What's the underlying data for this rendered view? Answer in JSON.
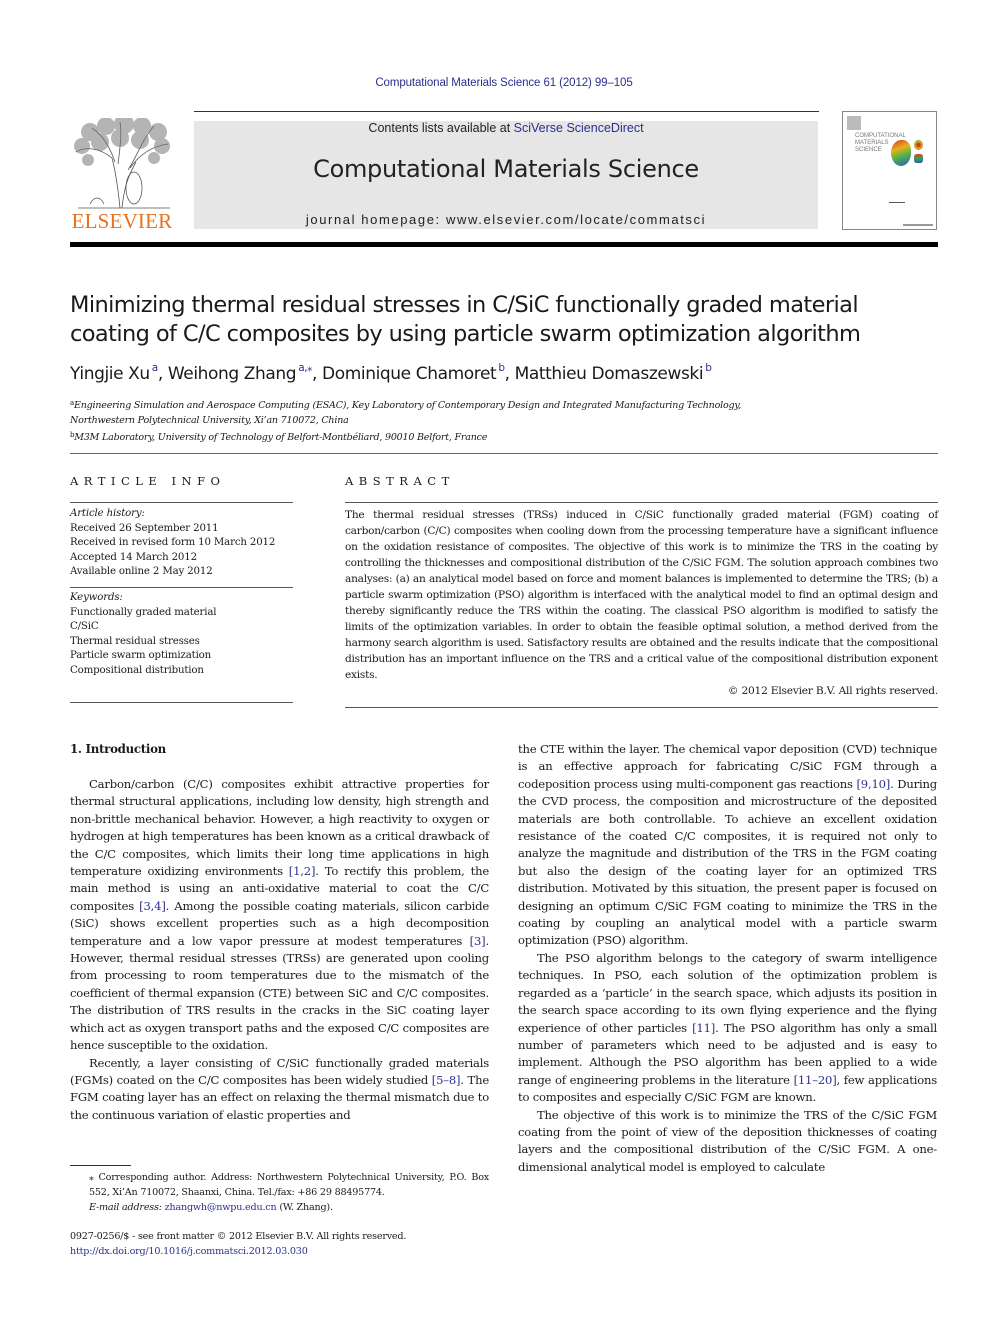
{
  "header": {
    "citation": "Computational Materials Science 61 (2012) 99–105",
    "contents_prefix": "Contents lists available at ",
    "contents_link": "SciVerse ScienceDirect",
    "journal_title": "Computational Materials Science",
    "homepage_prefix": "journal homepage: ",
    "homepage_url": "www.elsevier.com/locate/commatsci",
    "publisher_logo": "ELSEVIER",
    "cover_title_lines": [
      "COMPUTATIONAL",
      "MATERIALS",
      "SCIENCE"
    ],
    "colors": {
      "link": "#2b2f8f",
      "elsevier_orange": "#e9711c",
      "banner_bg": "#e6e6e6"
    }
  },
  "article": {
    "title_line1": "Minimizing thermal residual stresses in C/SiC functionally graded material",
    "title_line2": "coating of C/C composites by using particle swarm optimization algorithm",
    "authors": [
      {
        "name": "Yingjie Xu",
        "sup": "a"
      },
      {
        "name": "Weihong Zhang",
        "sup": "a,⁎"
      },
      {
        "name": "Dominique Chamoret",
        "sup": "b"
      },
      {
        "name": "Matthieu Domaszewski",
        "sup": "b"
      }
    ],
    "affiliations": [
      {
        "mark": "a",
        "line1": "Engineering Simulation and Aerospace Computing (ESAC), Key Laboratory of Contemporary Design and Integrated Manufacturing Technology,",
        "line2": "Northwestern Polytechnical University, Xi’an 710072, China"
      },
      {
        "mark": "b",
        "line1": "M3M Laboratory, University of Technology of Belfort-Montbéliard, 90010 Belfort, France"
      }
    ]
  },
  "article_info": {
    "heading": "ARTICLE INFO",
    "history_label": "Article history:",
    "history": [
      "Received 26 September 2011",
      "Received in revised form 10 March 2012",
      "Accepted 14 March 2012",
      "Available online 2 May 2012"
    ],
    "keywords_label": "Keywords:",
    "keywords": [
      "Functionally graded material",
      "C/SiC",
      "Thermal residual stresses",
      "Particle swarm optimization",
      "Compositional distribution"
    ]
  },
  "abstract": {
    "heading": "ABSTRACT",
    "text": "The thermal residual stresses (TRSs) induced in C/SiC functionally graded material (FGM) coating of carbon/carbon (C/C) composites when cooling down from the processing temperature have a significant influence on the oxidation resistance of composites. The objective of this work is to minimize the TRS in the coating by controlling the thicknesses and compositional distribution of the C/SiC FGM. The solution approach combines two analyses: (a) an analytical model based on force and moment balances is implemented to determine the TRS; (b) a particle swarm optimization (PSO) algorithm is interfaced with the analytical model to find an optimal design and thereby significantly reduce the TRS within the coating. The classical PSO algorithm is modified to satisfy the limits of the optimization variables. In order to obtain the feasible optimal solution, a method derived from the harmony search algorithm is used. Satisfactory results are obtained and the results indicate that the compositional distribution has an important influence on the TRS and a critical value of the compositional distribution exponent exists.",
    "copyright": "© 2012 Elsevier B.V. All rights reserved."
  },
  "introduction": {
    "heading": "1. Introduction",
    "left_paragraphs": [
      [
        {
          "t": "Carbon/carbon (C/C) composites exhibit attractive properties for thermal structural applications, including low density, high strength and non-brittle mechanical behavior. However, a high reactivity to oxygen or hydrogen at high temperatures has been known as a critical drawback of the C/C composites, which limits their long time applications in high temperature oxidizing environments "
        },
        {
          "ref": "[1,2]"
        },
        {
          "t": ". To rectify this problem, the main method is using an anti-oxidative material to coat the C/C composites "
        },
        {
          "ref": "[3,4]"
        },
        {
          "t": ". Among the possible coating materials, silicon carbide (SiC) shows excellent properties such as a high decomposition temperature and a low vapor pressure at modest temperatures "
        },
        {
          "ref": "[3]"
        },
        {
          "t": ". However, thermal residual stresses (TRSs) are generated upon cooling from processing to room temperatures due to the mismatch of the coefficient of thermal expansion (CTE) between SiC and C/C composites. The distribution of TRS results in the cracks in the SiC coating layer which act as oxygen transport paths and the exposed C/C composites are hence susceptible to the oxidation."
        }
      ],
      [
        {
          "t": "Recently, a layer consisting of C/SiC functionally graded materials (FGMs) coated on the C/C composites has been widely studied "
        },
        {
          "ref": "[5–8]"
        },
        {
          "t": ". The FGM coating layer has an effect on relaxing the thermal mismatch due to the continuous variation of elastic properties and"
        }
      ]
    ],
    "right_paragraphs": [
      [
        {
          "t": "the CTE within the layer. The chemical vapor deposition (CVD) technique is an effective approach for fabricating C/SiC FGM through a codeposition process using multi-component gas reactions "
        },
        {
          "ref": "[9,10]"
        },
        {
          "t": ". During the CVD process, the composition and microstructure of the deposited materials are both controllable. To achieve an excellent oxidation resistance of the coated C/C composites, it is required not only to analyze the magnitude and distribution of the TRS in the FGM coating but also the design of the coating layer for an optimized TRS distribution. Motivated by this situation, the present paper is focused on designing an optimum C/SiC FGM coating to minimize the TRS in the coating by coupling an analytical model with a particle swarm optimization (PSO) algorithm."
        }
      ],
      [
        {
          "t": "The PSO algorithm belongs to the category of swarm intelligence techniques. In PSO, each solution of the optimization problem is regarded as a ‘particle’ in the search space, which adjusts its position in the search space according to its own flying experience and the flying experience of other particles "
        },
        {
          "ref": "[11]"
        },
        {
          "t": ". The PSO algorithm has only a small number of parameters which need to be adjusted and is easy to implement. Although the PSO algorithm has been applied to a wide range of engineering problems in the literature "
        },
        {
          "ref": "[11–20]"
        },
        {
          "t": ", few applications to composites and especially C/SiC FGM are known."
        }
      ],
      [
        {
          "t": "The objective of this work is to minimize the TRS of the C/SiC FGM coating from the point of view of the deposition thicknesses of coating layers and the compositional distribution of the C/SiC FGM. A one-dimensional analytical model is employed to calculate"
        }
      ]
    ]
  },
  "footnote": {
    "marker": "⁎",
    "text": "Corresponding author. Address: Northwestern Polytechnical University, P.O. Box 552, Xi’An 710072, Shaanxi, China. Tel./fax: +86 29 88495774.",
    "email_label": "E-mail address:",
    "email": "zhangwh@nwpu.edu.cn",
    "email_suffix": " (W. Zhang)."
  },
  "front_matter": {
    "issn_line": "0927-0256/$ - see front matter © 2012 Elsevier B.V. All rights reserved.",
    "doi": "http://dx.doi.org/10.1016/j.commatsci.2012.03.030"
  }
}
